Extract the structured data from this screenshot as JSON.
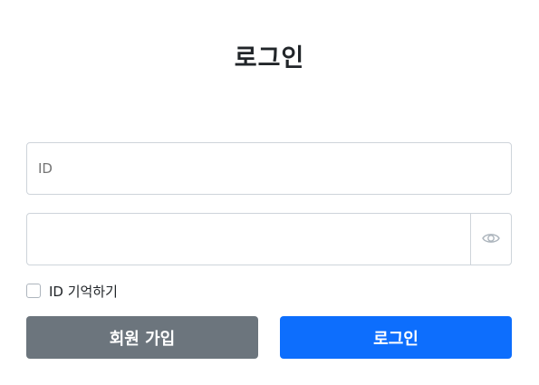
{
  "page": {
    "title": "로그인"
  },
  "form": {
    "id_field": {
      "value": "",
      "placeholder": "ID"
    },
    "password_field": {
      "value": "",
      "placeholder": "",
      "toggle_icon": "eye-icon"
    },
    "remember": {
      "label": "ID 기억하기",
      "checked": false
    }
  },
  "buttons": {
    "signup_label": "회원 가입",
    "login_label": "로그인"
  },
  "colors": {
    "signup_bg": "#6c757d",
    "login_bg": "#0d6efd",
    "border": "#ced4da"
  }
}
